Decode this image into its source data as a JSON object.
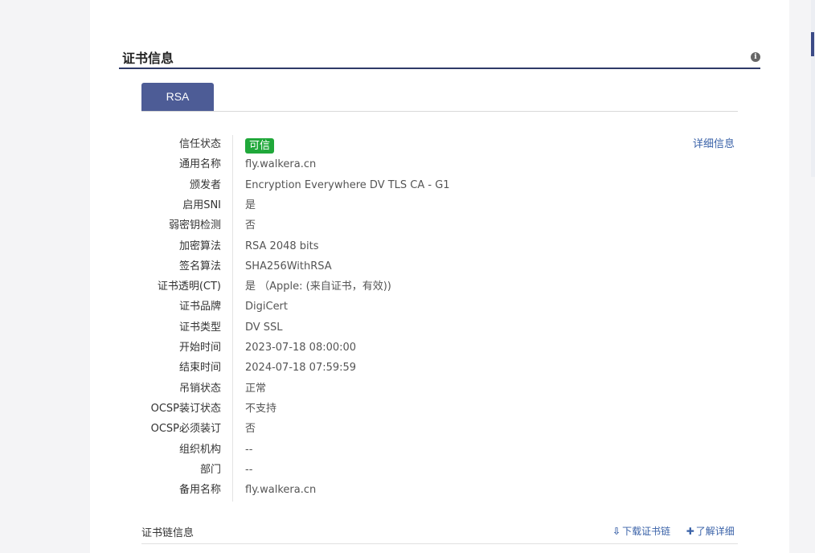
{
  "section": {
    "title": "证书信息",
    "info_icon": "info-icon"
  },
  "tabs": [
    {
      "label": "RSA",
      "active": true
    }
  ],
  "detail_link": "详细信息",
  "cert": {
    "rows": [
      {
        "label": "信任状态",
        "value": "可信",
        "badge": true,
        "badge_color": "#20a83a"
      },
      {
        "label": "通用名称",
        "value": "fly.walkera.cn"
      },
      {
        "label": "颁发者",
        "value": "Encryption Everywhere DV TLS CA - G1"
      },
      {
        "label": "启用SNI",
        "value": "是"
      },
      {
        "label": "弱密钥检测",
        "value": "否"
      },
      {
        "label": "加密算法",
        "value": "RSA 2048 bits"
      },
      {
        "label": "签名算法",
        "value": "SHA256WithRSA"
      },
      {
        "label": "证书透明(CT)",
        "value": "是 （Apple: (来自证书，有效))"
      },
      {
        "label": "证书品牌",
        "value": "DigiCert"
      },
      {
        "label": "证书类型",
        "value": "DV SSL"
      },
      {
        "label": "开始时间",
        "value": "2023-07-18 08:00:00"
      },
      {
        "label": "结束时间",
        "value": "2024-07-18 07:59:59"
      },
      {
        "label": "吊销状态",
        "value": "正常"
      },
      {
        "label": "OCSP装订状态",
        "value": "不支持"
      },
      {
        "label": "OCSP必须装订",
        "value": "否"
      },
      {
        "label": "组织机构",
        "value": "--"
      },
      {
        "label": "部门",
        "value": "--"
      },
      {
        "label": "备用名称",
        "value": "fly.walkera.cn"
      }
    ]
  },
  "chain": {
    "title": "证书链信息",
    "download_label": "下载证书链",
    "download_icon": "cloud-download-icon",
    "learn_label": "了解详细",
    "learn_icon": "plus-icon"
  },
  "colors": {
    "accent": "#4d5c96",
    "underline": "#2e3a68",
    "link": "#3a62a8",
    "trusted": "#20a83a"
  }
}
